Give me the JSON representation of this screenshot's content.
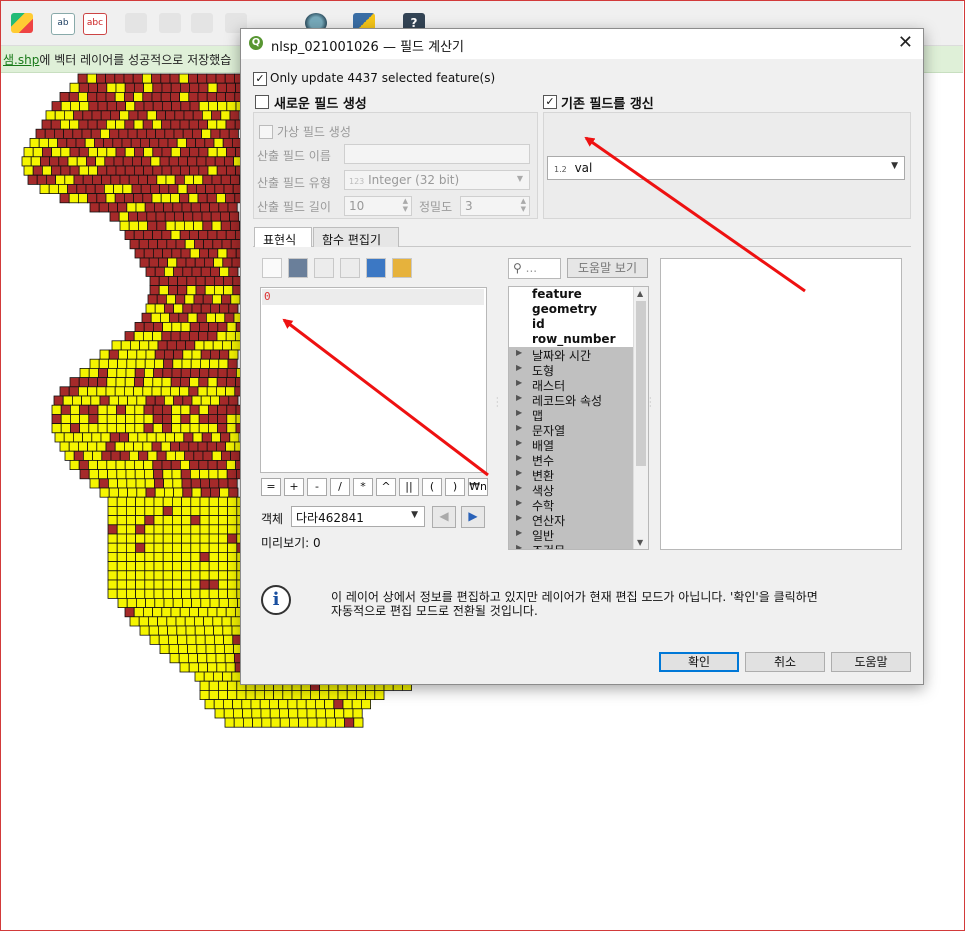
{
  "toolbar": {
    "label_tool_text": "ab",
    "label_tool_text2": "abc"
  },
  "message_bar": {
    "link_text": "샘.shp",
    "text": "에 벡터 레이어를 성공적으로 저장했습"
  },
  "dialog": {
    "title": "nlsp_021001026 — 필드 계산기",
    "only_selected_label": "Only update 4437 selected feature(s)",
    "only_selected_checked": true,
    "new_field": {
      "label": "새로운 필드 생성",
      "checked": false,
      "virtual_label": "가상 필드 생성",
      "name_label": "산출 필드 이름",
      "name_value": "",
      "type_label": "산출 필드 유형",
      "type_value": "Integer (32 bit)",
      "type_badge": "123",
      "length_label": "산출 필드 길이",
      "length_value": "10",
      "precision_label": "정밀도",
      "precision_value": "3"
    },
    "update_field": {
      "label": "기존 필드를 갱신",
      "checked": true,
      "field_badge": "1.2",
      "field_value": "val"
    },
    "tabs": [
      "표현식",
      "함수 편집기"
    ],
    "expression": "0",
    "operators": [
      "=",
      "+",
      "-",
      "/",
      "*",
      "^",
      "||",
      "(",
      ")",
      "₩n"
    ],
    "feature_label": "객체",
    "feature_value": "다라462841",
    "preview_label": "미리보기:",
    "preview_value": "0",
    "search_placeholder": "...",
    "show_help_label": "도움말 보기",
    "tree_fields": [
      "feature",
      "geometry",
      "id",
      "row_number"
    ],
    "tree_groups": [
      "날짜와 시간",
      "도형",
      "래스터",
      "레코드와 속성",
      "맵",
      "문자열",
      "배열",
      "변수",
      "변환",
      "색상",
      "수학",
      "연산자",
      "일반",
      "조건문"
    ],
    "info_message_line1": "이 레이어 상에서 정보를 편집하고 있지만 레이어가 현재 편집 모드가 아닙니다. '확인'을 클릭하면",
    "info_message_line2": "자동적으로 편집 모드로 전환될 것입니다.",
    "ok_label": "확인",
    "cancel_label": "취소",
    "help_label": "도움말"
  },
  "colors": {
    "map_fill": "#f5f500",
    "map_selected": "#a52a2a",
    "map_outline": "#111111",
    "annotation_arrow": "#ee1111",
    "message_bar": "#dff0d8"
  }
}
